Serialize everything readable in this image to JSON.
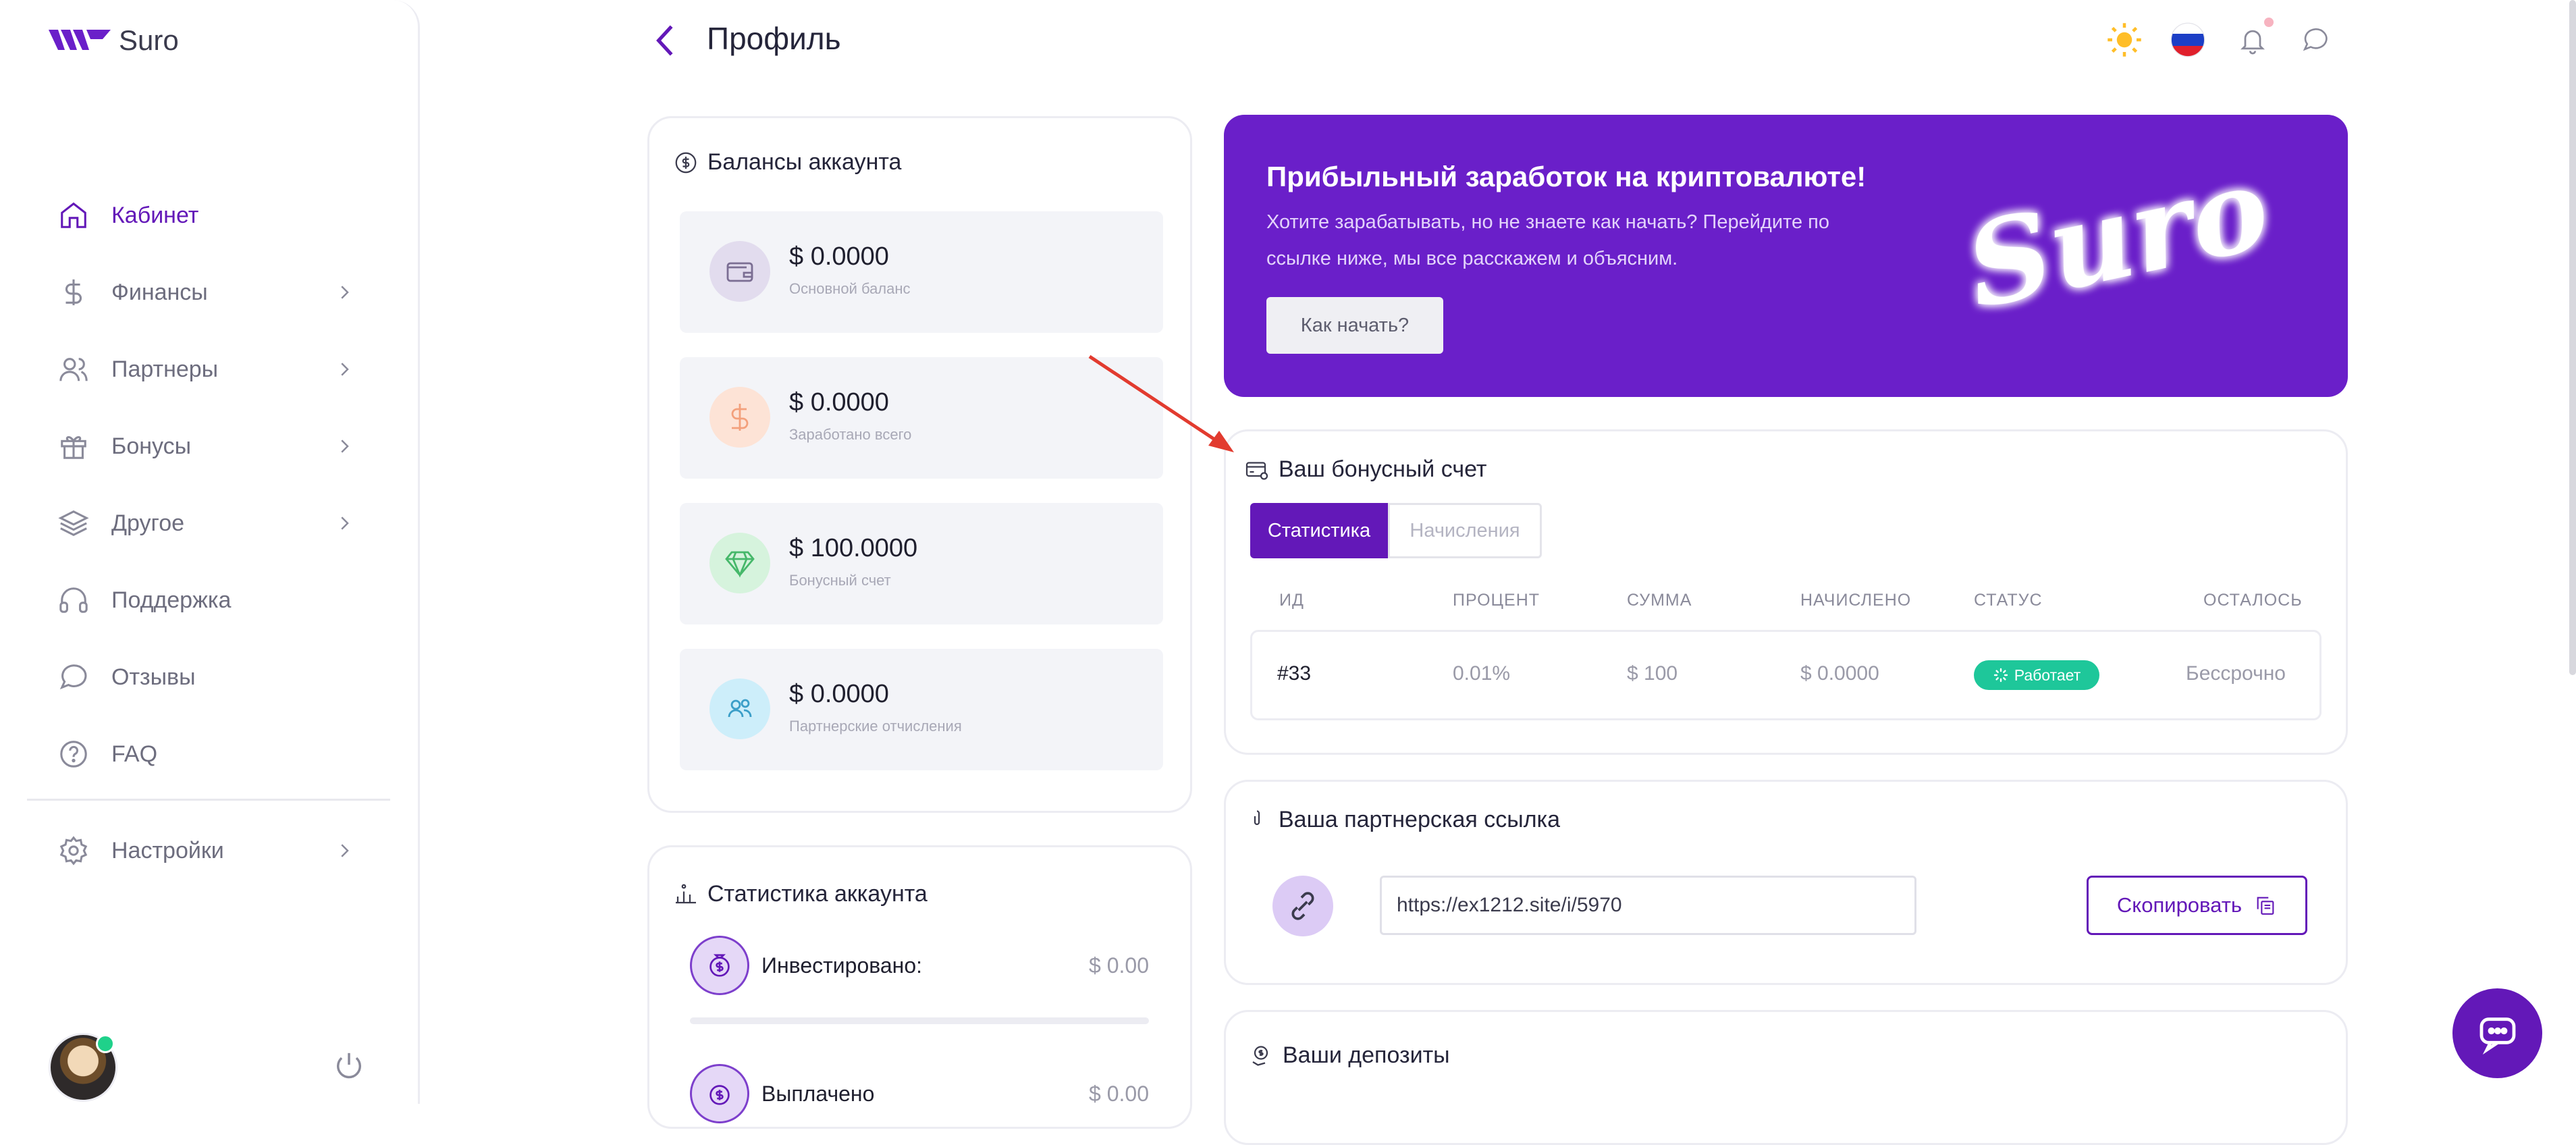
{
  "brand": {
    "name": "Suro"
  },
  "sidebar": {
    "items": [
      {
        "label": "Кабинет",
        "icon": "home-icon",
        "active": true,
        "expandable": false
      },
      {
        "label": "Финансы",
        "icon": "dollar-icon",
        "active": false,
        "expandable": true
      },
      {
        "label": "Партнеры",
        "icon": "users-icon",
        "active": false,
        "expandable": true
      },
      {
        "label": "Бонусы",
        "icon": "gift-icon",
        "active": false,
        "expandable": true
      },
      {
        "label": "Другое",
        "icon": "layers-icon",
        "active": false,
        "expandable": true
      },
      {
        "label": "Поддержка",
        "icon": "headphones-icon",
        "active": false,
        "expandable": false
      },
      {
        "label": "Отзывы",
        "icon": "chat-bubble-icon",
        "active": false,
        "expandable": false
      },
      {
        "label": "FAQ",
        "icon": "question-icon",
        "active": false,
        "expandable": false
      }
    ],
    "settings": {
      "label": "Настройки",
      "icon": "gear-icon"
    }
  },
  "header": {
    "title": "Профиль",
    "icons": [
      "sun-icon",
      "russia-flag-icon",
      "bell-icon",
      "message-icon"
    ]
  },
  "balances": {
    "title": "Балансы аккаунта",
    "items": [
      {
        "amount": "$ 0.0000",
        "label": "Основной баланс",
        "icon": "wallet-icon",
        "color": "#e2dcee"
      },
      {
        "amount": "$ 0.0000",
        "label": "Заработано всего",
        "icon": "dollar-icon",
        "color": "#fde3d6"
      },
      {
        "amount": "$ 100.0000",
        "label": "Бонусный счет",
        "icon": "diamond-icon",
        "color": "#d6f3dd"
      },
      {
        "amount": "$ 0.0000",
        "label": "Партнерские отчисления",
        "icon": "users-icon",
        "color": "#cdeefa"
      }
    ]
  },
  "stats": {
    "title": "Статистика аккаунта",
    "items": [
      {
        "label": "Инвестировано:",
        "value": "$ 0.00"
      },
      {
        "label": "Выплачено",
        "value": "$ 0.00"
      }
    ]
  },
  "promo": {
    "title": "Прибыльный заработок на криптовалюте!",
    "text": "Хотите зарабатывать, но не знаете как начать? Перейдите по ссылке ниже, мы все расскажем и объясним.",
    "button": "Как начать?",
    "logo_text": "Suro",
    "bg_color": "#6a1fc9"
  },
  "bonus_account": {
    "title": "Ваш бонусный счет",
    "tabs": [
      "Статистика",
      "Начисления"
    ],
    "active_tab": "Статистика",
    "columns": [
      "ИД",
      "ПРОЦЕНТ",
      "СУММА",
      "НАЧИСЛЕНО",
      "СТАТУС",
      "ОСТАЛОСЬ"
    ],
    "rows": [
      {
        "id": "#33",
        "percent": "0.01%",
        "sum": "$ 100",
        "accrued": "$ 0.0000",
        "status": "Работает",
        "remaining": "Бессрочно"
      }
    ],
    "status_color": "#1ec79a"
  },
  "partner_link": {
    "title": "Ваша партнерская ссылка",
    "url": "https://ex1212.site/i/5970",
    "copy_label": "Скопировать"
  },
  "deposits": {
    "title": "Ваши депозиты"
  },
  "colors": {
    "accent": "#6318b8",
    "border": "#ececf2"
  }
}
